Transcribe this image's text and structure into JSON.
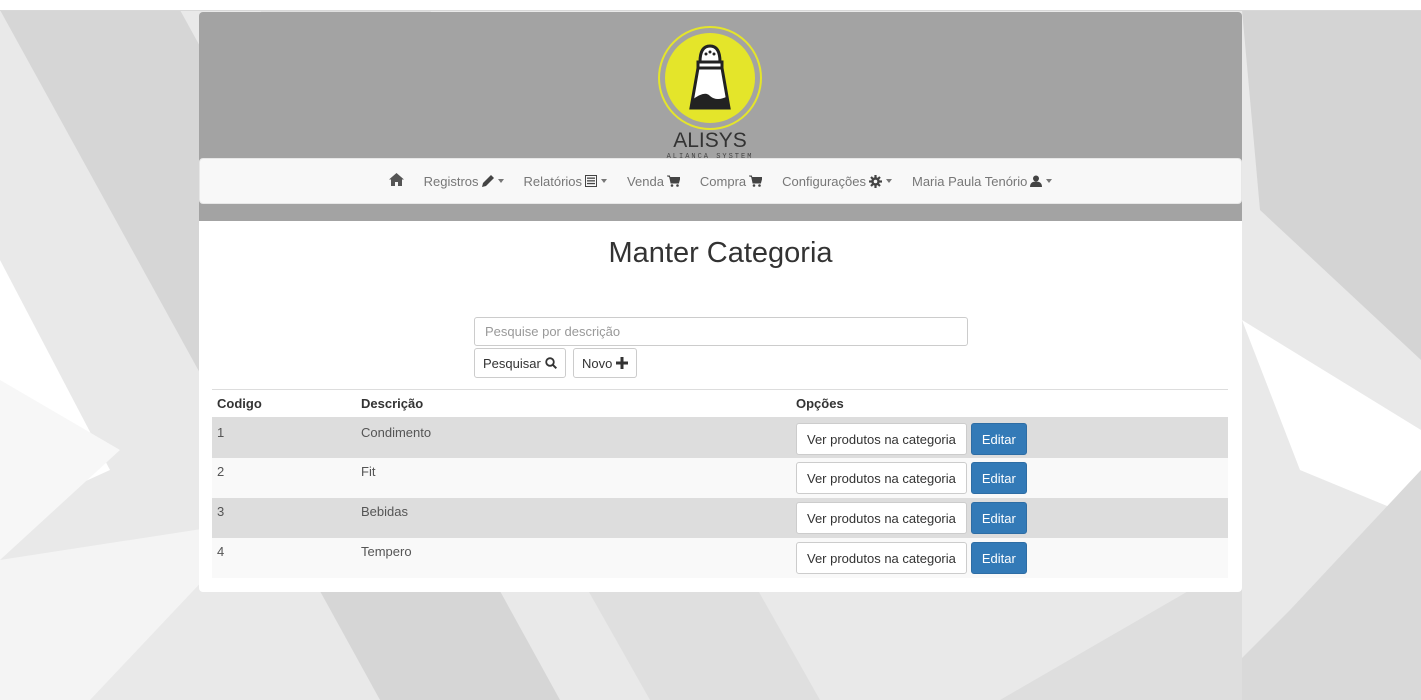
{
  "brand": {
    "name": "ALISYS",
    "tagline": "ALIANÇA SYSTEM",
    "logo_color": "#e4e52a"
  },
  "nav": {
    "home_icon": "home-icon",
    "items": [
      {
        "label": "Registros",
        "icon": "pencil-icon",
        "dropdown": true
      },
      {
        "label": "Relatórios",
        "icon": "list-icon",
        "dropdown": true
      },
      {
        "label": "Venda",
        "icon": "cart-icon",
        "dropdown": false
      },
      {
        "label": "Compra",
        "icon": "cart-icon",
        "dropdown": false
      },
      {
        "label": "Configurações",
        "icon": "gear-icon",
        "dropdown": true
      },
      {
        "label": "Maria Paula Tenório",
        "icon": "user-icon",
        "dropdown": true
      }
    ]
  },
  "page": {
    "title": "Manter Categoria"
  },
  "search": {
    "placeholder": "Pesquise por descrição",
    "value": "",
    "search_label": "Pesquisar",
    "new_label": "Novo"
  },
  "table": {
    "columns": [
      "Codigo",
      "Descrição",
      "Opções"
    ],
    "rows": [
      {
        "codigo": "1",
        "descricao": "Condimento"
      },
      {
        "codigo": "2",
        "descricao": "Fit"
      },
      {
        "codigo": "3",
        "descricao": "Bebidas"
      },
      {
        "codigo": "4",
        "descricao": "Tempero"
      }
    ],
    "view_label": "Ver produtos na categoria",
    "edit_label": "Editar"
  },
  "colors": {
    "header_bg": "#a3a3a3",
    "primary": "#337ab7",
    "navbar_bg": "#f8f8f8",
    "row_odd": "#dddddd",
    "row_even": "#f9f9f9"
  }
}
